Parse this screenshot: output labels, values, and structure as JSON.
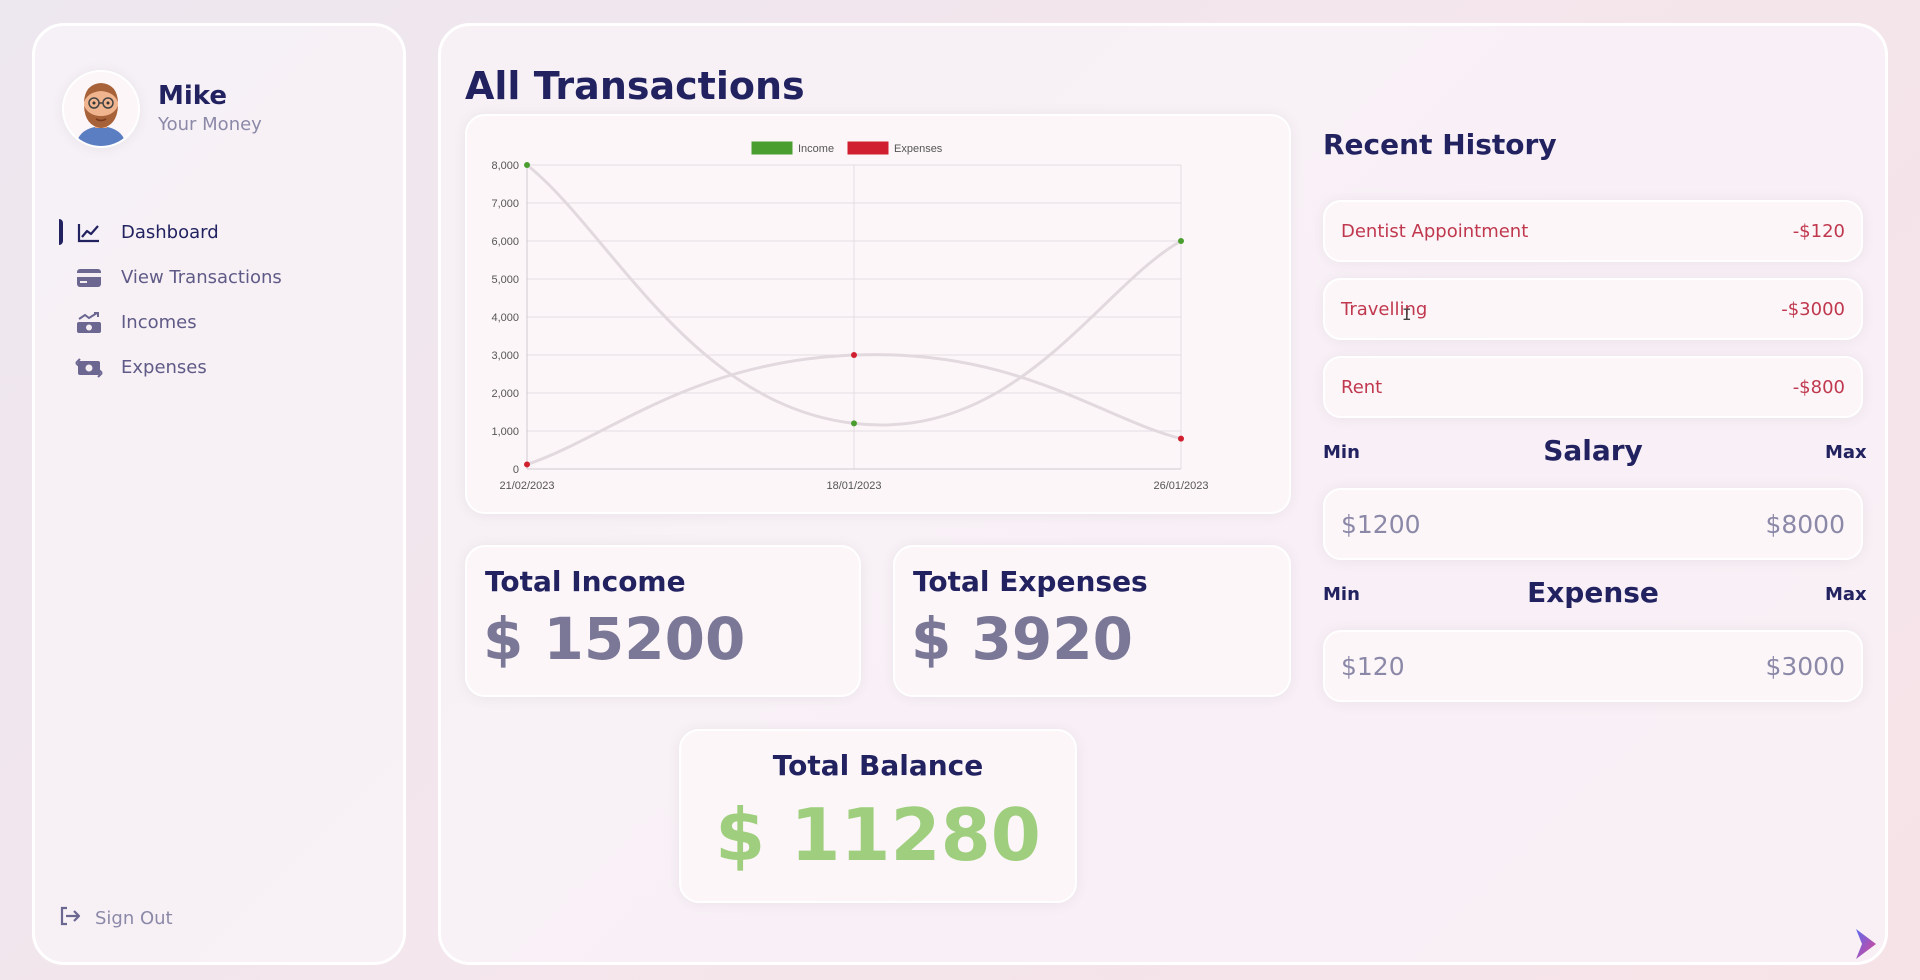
{
  "profile": {
    "name": "Mike",
    "subtitle": "Your Money",
    "avatar_icon": "bearded-man-avatar"
  },
  "menu": [
    {
      "label": "Dashboard",
      "icon": "chart-line-icon",
      "active": true
    },
    {
      "label": "View Transactions",
      "icon": "credit-card-icon",
      "active": false
    },
    {
      "label": "Incomes",
      "icon": "money-bill-trend-up-icon",
      "active": false
    },
    {
      "label": "Expenses",
      "icon": "money-bill-transfer-icon",
      "active": false
    }
  ],
  "signout": {
    "label": "Sign Out",
    "icon": "sign-out-icon"
  },
  "main": {
    "title": "All Transactions"
  },
  "chart_data": {
    "type": "line",
    "x": [
      "21/02/2023",
      "18/01/2023",
      "26/01/2023"
    ],
    "series": [
      {
        "name": "Income",
        "values": [
          8000,
          1200,
          6000
        ],
        "color": "#4a9e2f"
      },
      {
        "name": "Expenses",
        "values": [
          120,
          3000,
          800
        ],
        "color": "#d0202f"
      }
    ],
    "ylim": [
      0,
      8000
    ],
    "yticks": [
      "0",
      "1,000",
      "2,000",
      "3,000",
      "4,000",
      "5,000",
      "6,000",
      "7,000",
      "8,000"
    ],
    "legend": "top-center",
    "grid": true
  },
  "stats": {
    "income": {
      "title": "Total Income",
      "value": "$ 15200"
    },
    "expenses": {
      "title": "Total Expenses",
      "value": "$ 3920"
    },
    "balance": {
      "title": "Total Balance",
      "value": "$ 11280"
    }
  },
  "history": {
    "title": "Recent History",
    "items": [
      {
        "label": "Dentist Appointment",
        "amount": "-$120"
      },
      {
        "label": "Travelling",
        "amount": "-$3000"
      },
      {
        "label": "Rent",
        "amount": "-$800"
      }
    ]
  },
  "salary": {
    "title": "Salary",
    "min_label": "Min",
    "max_label": "Max",
    "min": "$1200",
    "max": "$8000"
  },
  "expense": {
    "title": "Expense",
    "min_label": "Min",
    "max_label": "Max",
    "min": "$120",
    "max": "$3000"
  },
  "colors": {
    "primary": "#222260",
    "expense_red": "#c0384e",
    "balance_green": "#9fcf7e",
    "muted": "#8c89a8"
  }
}
